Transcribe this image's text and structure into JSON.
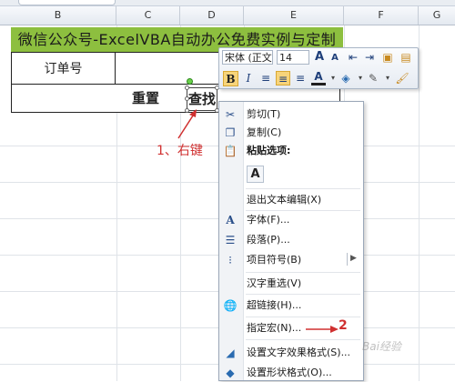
{
  "columns": [
    "B",
    "C",
    "D",
    "E",
    "F",
    "G"
  ],
  "banner": {
    "title": "微信公众号-ExcelVBA自动办公免费实例与定制"
  },
  "form": {
    "order_label": "订单号",
    "reset_label": "重置",
    "find_label": "查找"
  },
  "annotations": {
    "step1": "1、右键",
    "step2": "2"
  },
  "mini_toolbar": {
    "font_name": "宋体 (正文",
    "font_size": "14",
    "grow_font_icon": "A",
    "shrink_font_icon": "A",
    "bold_icon": "B",
    "italic_icon": "I",
    "font_color_icon": "A"
  },
  "context_menu": {
    "items": [
      {
        "label": "剪切(T)",
        "icon": "scissors-icon"
      },
      {
        "label": "复制(C)",
        "icon": "copy-icon"
      },
      {
        "label": "粘贴选项:",
        "icon": "paste-icon"
      },
      {
        "label": "退出文本编辑(X)",
        "icon": ""
      },
      {
        "label": "字体(F)...",
        "icon": "font-icon"
      },
      {
        "label": "段落(P)...",
        "icon": "paragraph-icon"
      },
      {
        "label": "项目符号(B)",
        "icon": "bullets-icon"
      },
      {
        "label": "汉字重选(V)",
        "icon": ""
      },
      {
        "label": "超链接(H)...",
        "icon": "hyperlink-icon"
      },
      {
        "label": "指定宏(N)...",
        "icon": ""
      },
      {
        "label": "设置文字效果格式(S)...",
        "icon": "text-effects-icon"
      },
      {
        "label": "设置形状格式(O)...",
        "icon": "shape-format-icon"
      }
    ],
    "paste_option_label": "A"
  },
  "watermark": "Bai经验",
  "colors": {
    "banner_bg": "#8dbf3f",
    "annotation": "#d03030",
    "highlight": "#f7d47a"
  }
}
